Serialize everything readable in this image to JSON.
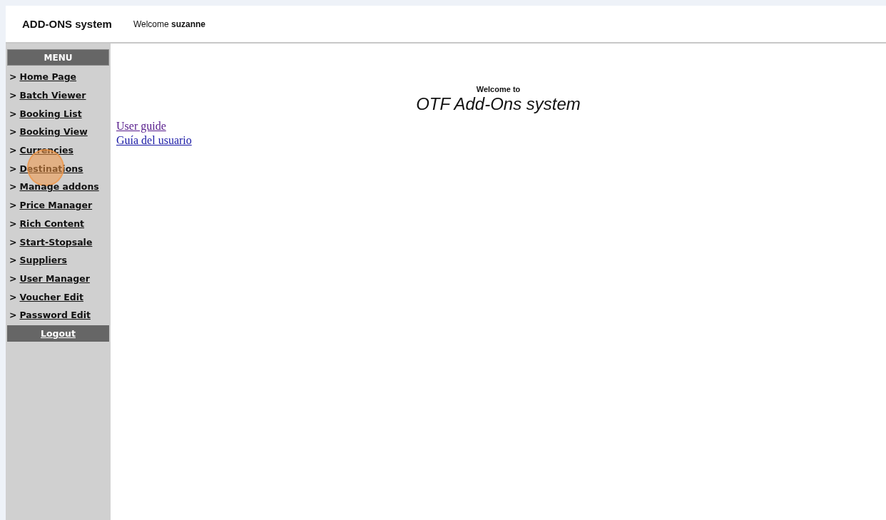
{
  "header": {
    "app_title": "ADD-ONS system",
    "welcome": "Welcome **suzanne**"
  },
  "menu": {
    "title": "MENU",
    "items": [
      {
        "label": "> Home Page",
        "clicked": false
      },
      {
        "label": "> Batch Viewer",
        "clicked": false
      },
      {
        "label": "> Booking List",
        "clicked": false
      },
      {
        "label": "> Booking View",
        "clicked": false
      },
      {
        "label": "> Currencies",
        "clicked": false
      },
      {
        "label": "> Destinations",
        "clicked": true
      },
      {
        "label": "> Manage addons",
        "clicked": false
      },
      {
        "label": "> Price Manager",
        "clicked": false
      },
      {
        "label": "> Rich Content",
        "clicked": false
      },
      {
        "label": "> Start-Stopsale",
        "clicked": false
      },
      {
        "label": "> Suppliers",
        "clicked": false
      },
      {
        "label": "> User Manager",
        "clicked": false
      },
      {
        "label": "> Voucher Edit",
        "clicked": false
      },
      {
        "label": "> Password Edit",
        "clicked": false
      }
    ],
    "logout": "Logout"
  },
  "main": {
    "greeting": "Welcome to",
    "system_name": "OTF Add-Ons system",
    "links": [
      {
        "label": "User guide",
        "visited": true
      },
      {
        "label": "Guía del usuario",
        "visited": false
      }
    ]
  }
}
